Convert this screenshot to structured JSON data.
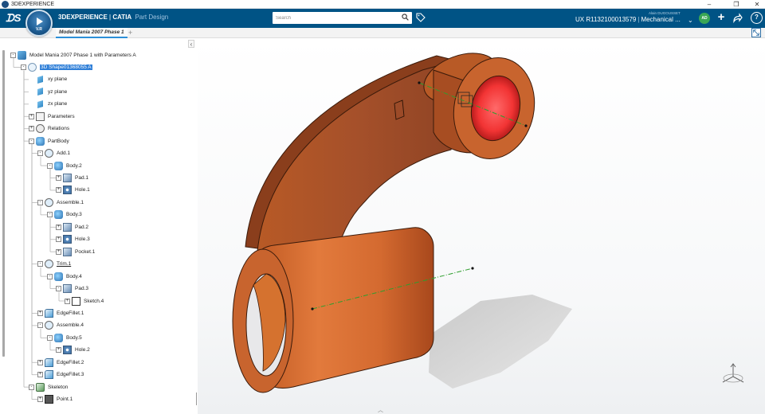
{
  "window": {
    "title": "3DEXPERIENCE",
    "minimize": "–",
    "restore": "❐",
    "close": "✕"
  },
  "header": {
    "brand_bold": "3DEXPERIENCE",
    "brand_sep": "|",
    "brand_app": "CATIA",
    "brand_module": "Part Design",
    "compass_label": "V.R",
    "search_placeholder": "Search",
    "user_name": "Alain DUGOUSSET",
    "context_code": "UX R1132100013579",
    "context_sep": "|",
    "context_role": "Mechanical ...",
    "avatar_initials": "AD",
    "accent_color": "#005385"
  },
  "tabs": {
    "active": "Model Mania 2007 Phase 1",
    "add": "+"
  },
  "tree": {
    "collapse_symbol": "‹",
    "nodes": [
      {
        "label": "Model Mania 2007 Phase 1 with Parameters A",
        "icon": "product-icon",
        "expander": "-"
      },
      {
        "label": "3D Shape01368055 A",
        "icon": "shape-icon",
        "expander": "-",
        "selected": true
      },
      {
        "label": "xy plane",
        "icon": "plane-icon",
        "expander": ""
      },
      {
        "label": "yz plane",
        "icon": "plane-icon",
        "expander": ""
      },
      {
        "label": "zx plane",
        "icon": "plane-icon",
        "expander": ""
      },
      {
        "label": "Parameters",
        "icon": "parameters-icon",
        "expander": "+"
      },
      {
        "label": "Relations",
        "icon": "relations-icon",
        "expander": "+"
      },
      {
        "label": "PartBody",
        "icon": "body-icon",
        "expander": "-"
      },
      {
        "label": "Add.1",
        "icon": "boolean-icon",
        "expander": "-"
      },
      {
        "label": "Body.2",
        "icon": "body-icon",
        "expander": "-"
      },
      {
        "label": "Pad.1",
        "icon": "pad-icon",
        "expander": "+"
      },
      {
        "label": "Hole.1",
        "icon": "hole-icon",
        "expander": "+"
      },
      {
        "label": "Assemble.1",
        "icon": "boolean-icon",
        "expander": "-"
      },
      {
        "label": "Body.3",
        "icon": "body-icon",
        "expander": "-"
      },
      {
        "label": "Pad.2",
        "icon": "pad-icon",
        "expander": "+"
      },
      {
        "label": "Hole.3",
        "icon": "hole-icon",
        "expander": "+"
      },
      {
        "label": "Pocket.1",
        "icon": "pad-icon",
        "expander": "+"
      },
      {
        "label": "Trim.1",
        "icon": "boolean-icon",
        "expander": "-",
        "underline": true
      },
      {
        "label": "Body.4",
        "icon": "body-icon",
        "expander": "-"
      },
      {
        "label": "Pad.3",
        "icon": "pad-icon",
        "expander": "-"
      },
      {
        "label": "Sketch.4",
        "icon": "sketch-icon",
        "expander": "+"
      },
      {
        "label": "EdgeFillet.1",
        "icon": "fillet-icon",
        "expander": "+"
      },
      {
        "label": "Assemble.4",
        "icon": "boolean-icon",
        "expander": "-"
      },
      {
        "label": "Body.5",
        "icon": "body-icon",
        "expander": "-"
      },
      {
        "label": "Hole.2",
        "icon": "hole-icon",
        "expander": "+"
      },
      {
        "label": "EdgeFillet.2",
        "icon": "fillet-icon",
        "expander": "+"
      },
      {
        "label": "EdgeFillet.3",
        "icon": "fillet-icon",
        "expander": "+"
      },
      {
        "label": "Skeleton",
        "icon": "skeleton-icon",
        "expander": "-"
      },
      {
        "label": "Point.1",
        "icon": "point-icon",
        "expander": "+"
      }
    ]
  },
  "model": {
    "body_color": "#c8642e",
    "inner_hole_color": "#ff3b3b",
    "axis_color": "#2e9e2e"
  },
  "viewport": {
    "bottom_arrow": "︿"
  }
}
